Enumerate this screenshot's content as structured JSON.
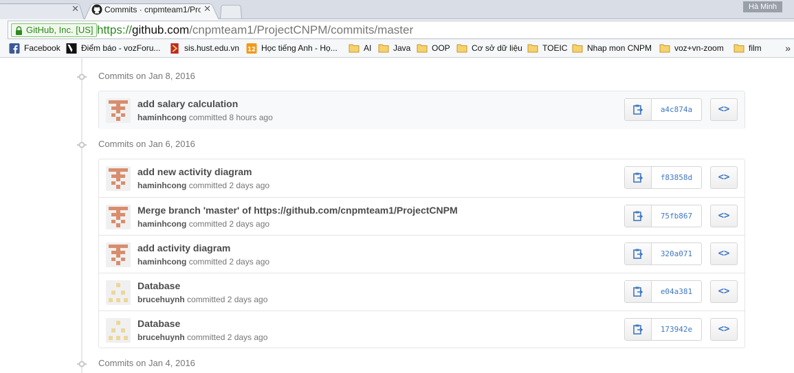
{
  "browser": {
    "tabs": [
      {
        "title": ""
      },
      {
        "title": "Commits · cnpmteam1/Pro"
      }
    ],
    "user": "Hà Minh",
    "ev_badge": "GitHub, Inc. [US]",
    "url": {
      "scheme": "https://",
      "host": "github.com",
      "path": "/cnpmteam1/ProjectCNPM/commits/master"
    },
    "bookmarks": [
      {
        "label": "Facebook",
        "icon": "facebook-icon"
      },
      {
        "label": "Điểm báo - vozForu...",
        "icon": "voz-icon"
      },
      {
        "label": "sis.hust.edu.vn",
        "icon": "hust-icon"
      },
      {
        "label": "Học tiếng Anh - Họ...",
        "icon": "english-icon"
      },
      {
        "label": "AI",
        "icon": "folder-icon"
      },
      {
        "label": "Java",
        "icon": "folder-icon"
      },
      {
        "label": "OOP",
        "icon": "folder-icon"
      },
      {
        "label": "Cơ sở dữ liệu",
        "icon": "folder-icon"
      },
      {
        "label": "TOEIC",
        "icon": "folder-icon"
      },
      {
        "label": "Nhap mon CNPM",
        "icon": "folder-icon"
      },
      {
        "label": "voz+vn-zoom",
        "icon": "folder-icon"
      },
      {
        "label": "film",
        "icon": "folder-icon"
      }
    ],
    "bookmarks_more": "»"
  },
  "commit_days": [
    {
      "label": "Commits on Jan 8, 2016",
      "commits": [
        {
          "message": "add salary calculation",
          "author": "haminhcong",
          "when": "committed 8 hours ago",
          "sha": "a4c874a",
          "avatar": "pink"
        }
      ]
    },
    {
      "label": "Commits on Jan 6, 2016",
      "commits": [
        {
          "message": "add new activity diagram",
          "author": "haminhcong",
          "when": "committed 2 days ago",
          "sha": "f83858d",
          "avatar": "pink"
        },
        {
          "message": "Merge branch 'master' of https://github.com/cnpmteam1/ProjectCNPM",
          "author": "haminhcong",
          "when": "committed 2 days ago",
          "sha": "75fb867",
          "avatar": "pink"
        },
        {
          "message": "add activity diagram",
          "author": "haminhcong",
          "when": "committed 2 days ago",
          "sha": "320a071",
          "avatar": "pink"
        },
        {
          "message": "Database",
          "author": "brucehuynh",
          "when": "committed 2 days ago",
          "sha": "e04a381",
          "avatar": "yellow"
        },
        {
          "message": "Database",
          "author": "brucehuynh",
          "when": "committed 2 days ago",
          "sha": "173942e",
          "avatar": "yellow"
        }
      ]
    },
    {
      "label": "Commits on Jan 4, 2016",
      "commits": []
    }
  ],
  "browse_label": "<>",
  "colors": {
    "pink_avatar": "#d98d6d",
    "yellow_avatar": "#ecd79b",
    "link": "#4078c0"
  }
}
